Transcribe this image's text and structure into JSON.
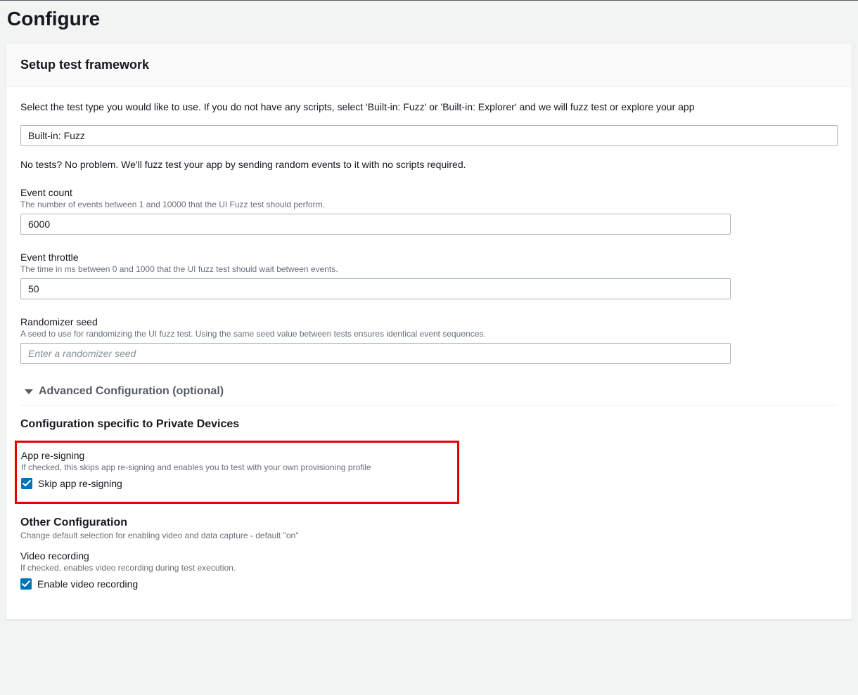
{
  "page": {
    "title": "Configure"
  },
  "panel": {
    "title": "Setup test framework",
    "intro": "Select the test type you would like to use. If you do not have any scripts, select 'Built-in: Fuzz' or 'Built-in: Explorer' and we will fuzz test or explore your app",
    "testTypeSelected": "Built-in: Fuzz",
    "helpText": "No tests? No problem. We'll fuzz test your app by sending random events to it with no scripts required."
  },
  "eventCount": {
    "label": "Event count",
    "hint": "The number of events between 1 and 10000 that the UI Fuzz test should perform.",
    "value": "6000"
  },
  "eventThrottle": {
    "label": "Event throttle",
    "hint": "The time in ms between 0 and 1000 that the UI fuzz test should wait between events.",
    "value": "50"
  },
  "randomizerSeed": {
    "label": "Randomizer seed",
    "hint": "A seed to use for randomizing the UI fuzz test. Using the same seed value between tests ensures identical event sequences.",
    "placeholder": "Enter a randomizer seed",
    "value": ""
  },
  "advanced": {
    "label": "Advanced Configuration (optional)"
  },
  "privateDevices": {
    "sectionTitle": "Configuration specific to Private Devices",
    "appResigning": {
      "label": "App re-signing",
      "hint": "If checked, this skips app re-signing and enables you to test with your own provisioning profile",
      "checkboxLabel": "Skip app re-signing",
      "checked": true
    }
  },
  "otherConfig": {
    "sectionTitle": "Other Configuration",
    "hint": "Change default selection for enabling video and data capture - default \"on\"",
    "videoRecording": {
      "label": "Video recording",
      "hint": "If checked, enables video recording during test execution.",
      "checkboxLabel": "Enable video recording",
      "checked": true
    }
  }
}
